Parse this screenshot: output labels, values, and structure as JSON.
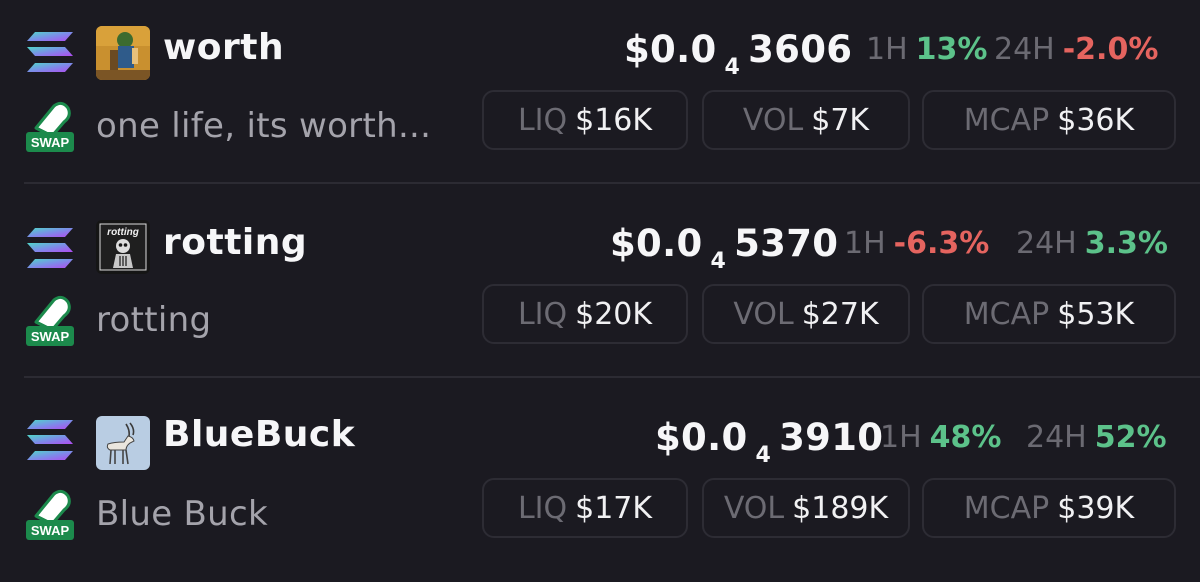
{
  "tokens": [
    {
      "name": "worth",
      "description": "one life, its worth...",
      "price": {
        "prefix": "$0.0",
        "zeros": "4",
        "digits": "3606"
      },
      "change_1h": {
        "label": "1H",
        "value": "13%",
        "direction": "up"
      },
      "change_24h": {
        "label": "24H",
        "value": "-2.0%",
        "direction": "down"
      },
      "liq": {
        "label": "LIQ",
        "value": "$16K"
      },
      "vol": {
        "label": "VOL",
        "value": "$7K"
      },
      "mcap": {
        "label": "MCAP",
        "value": "$36K"
      },
      "swap_label": "SWAP",
      "logo_icon": "character-avatar-icon"
    },
    {
      "name": "rotting",
      "description": "rotting",
      "price": {
        "prefix": "$0.0",
        "zeros": "4",
        "digits": "5370"
      },
      "change_1h": {
        "label": "1H",
        "value": "-6.3%",
        "direction": "down"
      },
      "change_24h": {
        "label": "24H",
        "value": "3.3%",
        "direction": "up"
      },
      "liq": {
        "label": "LIQ",
        "value": "$20K"
      },
      "vol": {
        "label": "VOL",
        "value": "$27K"
      },
      "mcap": {
        "label": "MCAP",
        "value": "$53K"
      },
      "swap_label": "SWAP",
      "logo_icon": "skeleton-logo-icon",
      "logo_text": "rotting"
    },
    {
      "name": "BlueBuck",
      "description": "Blue Buck",
      "price": {
        "prefix": "$0.0",
        "zeros": "4",
        "digits": "3910"
      },
      "change_1h": {
        "label": "1H",
        "value": "48%",
        "direction": "up"
      },
      "change_24h": {
        "label": "24H",
        "value": "52%",
        "direction": "up"
      },
      "liq": {
        "label": "LIQ",
        "value": "$17K"
      },
      "vol": {
        "label": "VOL",
        "value": "$189K"
      },
      "mcap": {
        "label": "MCAP",
        "value": "$39K"
      },
      "swap_label": "SWAP",
      "logo_icon": "antelope-logo-icon"
    }
  ],
  "colors": {
    "background": "#1b1a21",
    "positive": "#5cc28a",
    "negative": "#e5645f",
    "muted_label": "#6c6b73",
    "pill_border": "#2d2c34"
  }
}
